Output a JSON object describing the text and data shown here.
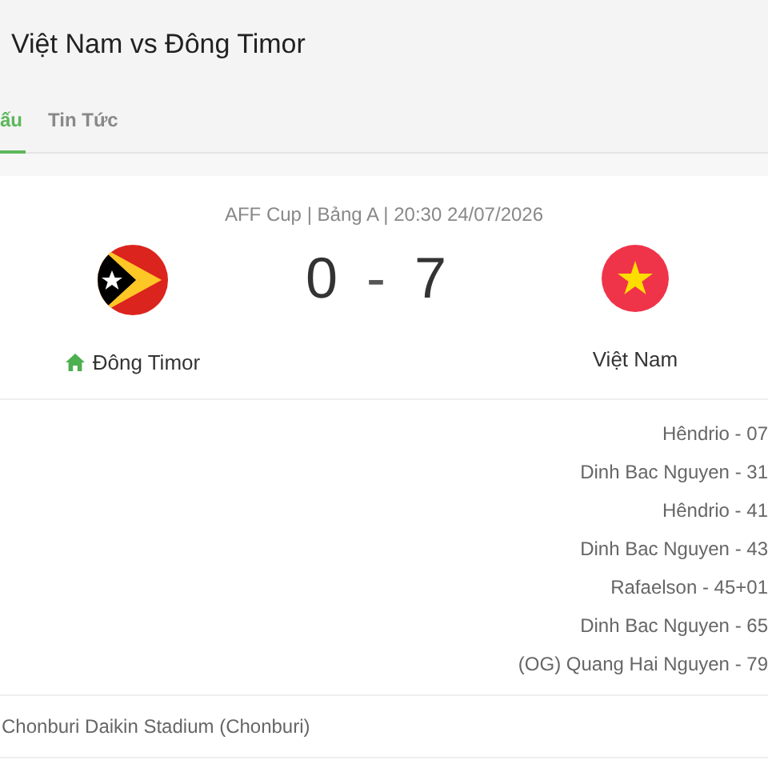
{
  "header": {
    "title": "Việt Nam vs Đông Timor"
  },
  "tabs": [
    {
      "label": "ấu",
      "selected": true
    },
    {
      "label": "Tin Tức",
      "selected": false
    }
  ],
  "match": {
    "meta": "AFF Cup | Bảng A | 20:30 24/07/2026",
    "home": {
      "name": "Đông Timor",
      "is_home": true
    },
    "score_home": "0",
    "separator": "-",
    "score_away": "7",
    "away": {
      "name": "Việt Nam",
      "is_home": false
    }
  },
  "scorers": [
    "Hêndrio - 07",
    "Dinh Bac Nguyen - 31",
    "Hêndrio - 41",
    "Dinh Bac Nguyen - 43",
    "Rafaelson - 45+01",
    "Dinh Bac Nguyen - 65",
    "(OG) Quang Hai Nguyen - 79"
  ],
  "venue": "Chonburi Daikin Stadium (Chonburi)"
}
